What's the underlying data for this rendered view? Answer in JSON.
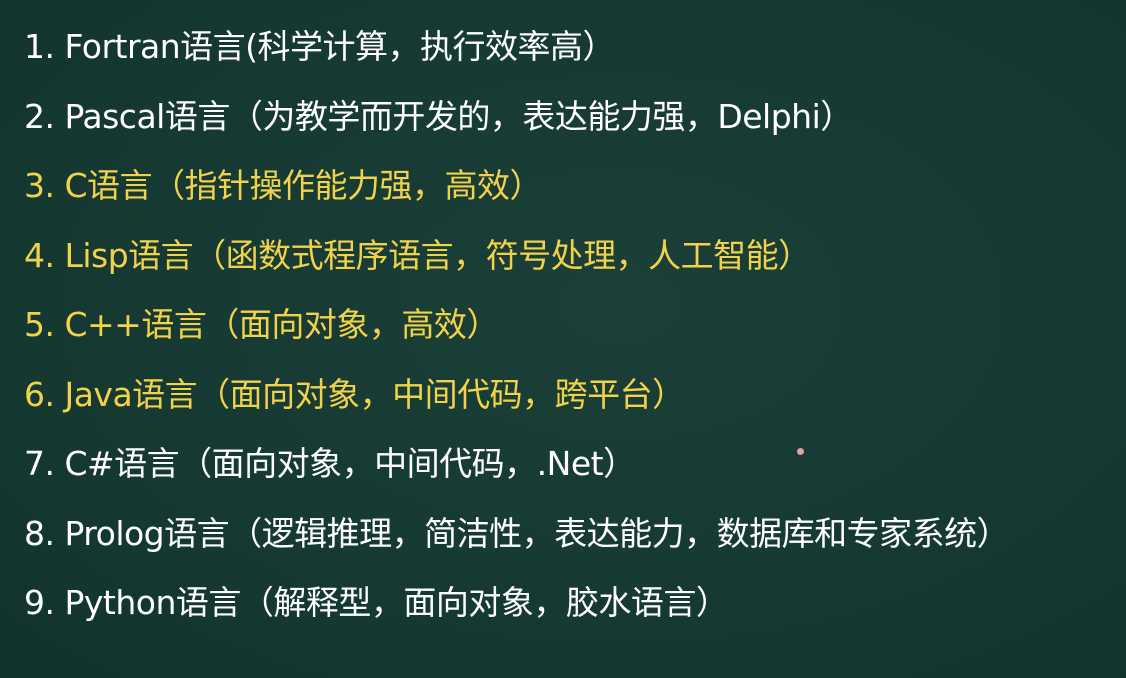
{
  "items": [
    {
      "text": "1. Fortran语言(科学计算，执行效率高）",
      "color": "#ffffff"
    },
    {
      "text": "2. Pascal语言（为教学而开发的，表达能力强，Delphi）",
      "color": "#ffffff"
    },
    {
      "text": "3. C语言（指针操作能力强，高效）",
      "color": "#f2d24a"
    },
    {
      "text": "4. Lisp语言（函数式程序语言，符号处理，人工智能）",
      "color": "#f2d24a"
    },
    {
      "text": "5. C++语言（面向对象，高效）",
      "color": "#f2d24a"
    },
    {
      "text": "6. Java语言（面向对象，中间代码，跨平台）",
      "color": "#f2d24a"
    },
    {
      "text": "7. C#语言（面向对象，中间代码，.Net）",
      "color": "#ffffff"
    },
    {
      "text": "8. Prolog语言（逻辑推理，简洁性，表达能力，数据库和专家系统）",
      "color": "#ffffff"
    },
    {
      "text": "9. Python语言（解释型，面向对象，胶水语言）",
      "color": "#ffffff"
    }
  ],
  "colors": {
    "background": "#163a33",
    "text_white": "#ffffff",
    "text_yellow": "#f2d24a",
    "pointer_dot": "#e7a1a6"
  }
}
